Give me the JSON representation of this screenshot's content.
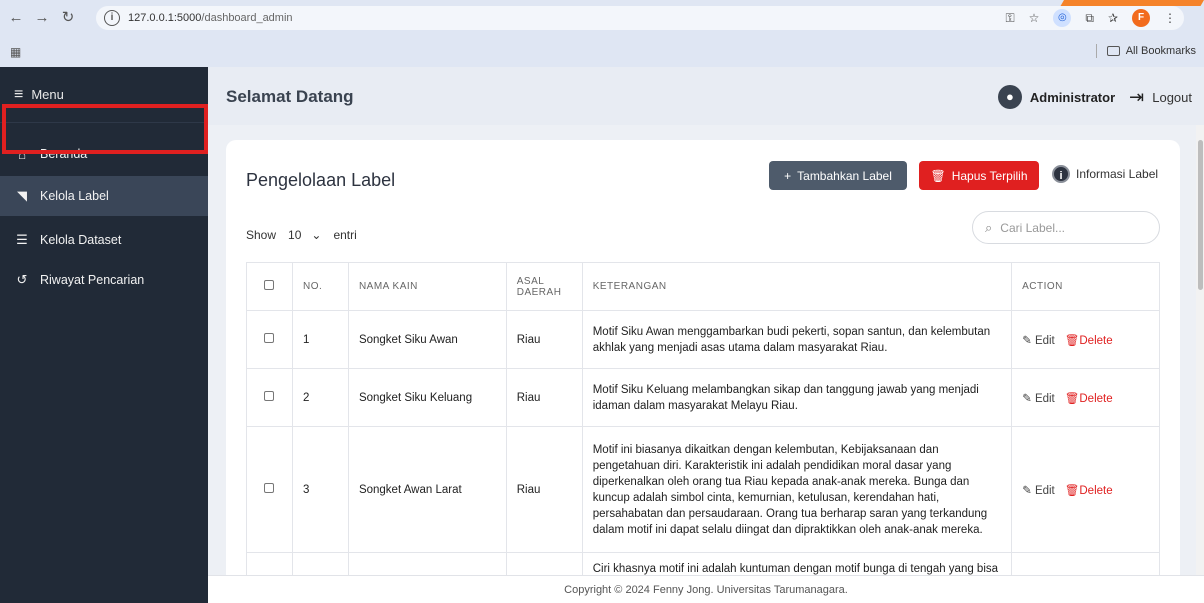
{
  "browser": {
    "url_host": "127.0.0.1:5000",
    "url_path": "/dashboard_admin",
    "all_bookmarks": "All Bookmarks",
    "profile_initial": "F"
  },
  "sidebar": {
    "menu_label": "Menu",
    "items": [
      {
        "label": "Beranda",
        "icon": "home-icon"
      },
      {
        "label": "Kelola Label",
        "icon": "tag-icon"
      },
      {
        "label": "Kelola Dataset",
        "icon": "database-icon"
      },
      {
        "label": "Riwayat Pencarian",
        "icon": "history-icon"
      }
    ]
  },
  "header": {
    "title": "Selamat Datang",
    "user": "Administrator",
    "logout": "Logout"
  },
  "card": {
    "title": "Pengelolaan Label",
    "add_button": "Tambahkan Label",
    "delete_selected_button": "Hapus Terpilih",
    "info_link": "Informasi Label",
    "show_label": "Show",
    "show_value": "10",
    "entries_label": "entri",
    "search_placeholder": "Cari Label..."
  },
  "table": {
    "headers": [
      "NO.",
      "NAMA KAIN",
      "ASAL DAERAH",
      "KETERANGAN",
      "ACTION"
    ],
    "rows": [
      {
        "no": "1",
        "nama": "Songket Siku Awan",
        "asal": "Riau",
        "ket": "Motif Siku Awan menggambarkan budi pekerti, sopan santun, dan kelembutan akhlak yang menjadi asas utama dalam masyarakat Riau."
      },
      {
        "no": "2",
        "nama": "Songket Siku Keluang",
        "asal": "Riau",
        "ket": "Motif Siku Keluang melambangkan sikap dan tanggung jawab yang menjadi idaman dalam masyarakat Melayu Riau."
      },
      {
        "no": "3",
        "nama": "Songket Awan Larat",
        "asal": "Riau",
        "ket": "Motif ini biasanya dikaitkan dengan kelembutan, Kebijaksanaan dan pengetahuan diri. Karakteristik ini adalah pendidikan moral dasar yang diperkenalkan oleh orang tua Riau kepada anak-anak mereka. Bunga dan kuncup adalah simbol cinta, kemurnian, ketulusan, kerendahan hati, persahabatan dan persaudaraan. Orang tua berharap saran yang terkandung dalam motif ini dapat selalu diingat dan dipraktikkan oleh anak-anak mereka."
      },
      {
        "no": "",
        "nama": "",
        "asal": "",
        "ket": "Ciri khasnya motif ini adalah kuntuman dengan motif bunga di tengah yang bisa"
      }
    ],
    "edit_label": "Edit",
    "delete_label": "Delete"
  },
  "footer": {
    "text": "Copyright © 2024 Fenny Jong. Universitas Tarumanagara."
  }
}
